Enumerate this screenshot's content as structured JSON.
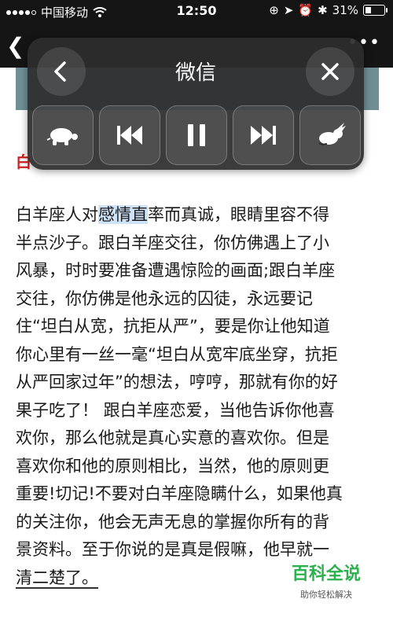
{
  "status_bar": {
    "carrier": "中国移动",
    "time": "12:50",
    "battery_percent": "31%"
  },
  "panel": {
    "title": "微信"
  },
  "content_lines": [
    [
      "白羊座人对",
      "感情直",
      "率而真诚，眼睛里容不得"
    ],
    "半点沙子。跟白羊座交往，你仿佛遇上了小",
    "风暴，时时要准备遭遇惊险的画面;跟白羊座",
    "交往，你仿佛是他永远的囚徒，永远要记",
    "住“坦白从宽，抗拒从严”，要是你让他知道",
    "你心里有一丝一毫“坦白从宽牢底坐穿，抗拒",
    "从严回家过年”的想法，哼哼，那就有你的好",
    "果子吃了！ 跟白羊座恋爱，当他告诉你他喜",
    "欢你，那么他就是真心实意的喜欢你。但是",
    "喜欢你和他的原则相比，当然，他的原则更",
    "重要!切记!不要对白羊座隐瞒什么，如果他真",
    "的关注你，他会无声无息的掌握你所有的背",
    "景资料。至于你说的是真是假嘛，他早就一",
    "清二楚了。"
  ],
  "watermark": {
    "title": "百科全说",
    "subtitle": "助你轻松解决"
  },
  "colors": {
    "panel_bg": "#2d2d2d",
    "highlight": "#cfe3f8",
    "watermark_green": "#2bb24c"
  }
}
